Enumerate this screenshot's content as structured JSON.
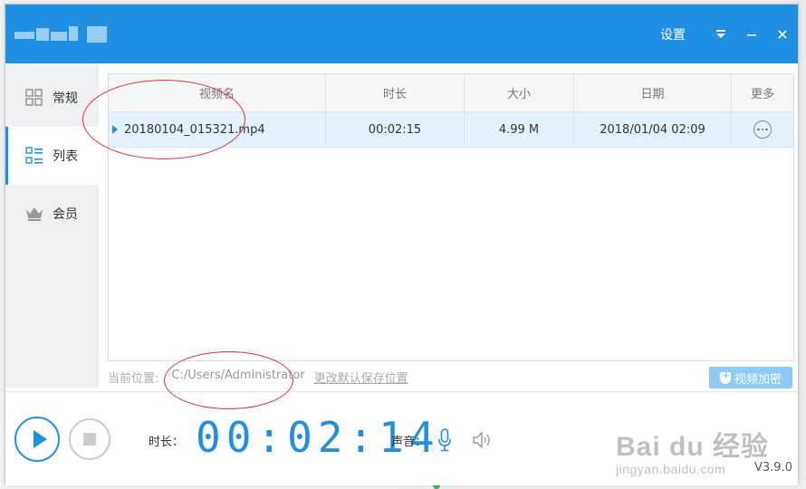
{
  "titlebar": {
    "settings_label": "设置",
    "icons": [
      "dropdown-icon",
      "minimize-icon",
      "close-icon"
    ],
    "accent_color": "#1e8fe3"
  },
  "sidebar": {
    "items": [
      {
        "label": "常规",
        "icon": "grid-icon",
        "active": false
      },
      {
        "label": "列表",
        "icon": "list-icon",
        "active": true
      },
      {
        "label": "会员",
        "icon": "crown-icon",
        "active": false
      }
    ]
  },
  "table": {
    "columns": [
      "视频名",
      "时长",
      "大小",
      "日期",
      "更多"
    ],
    "rows": [
      {
        "name": "20180104_015321.mp4",
        "duration": "00:02:15",
        "size": "4.99 M",
        "date": "2018/01/04 02:09",
        "more_icon": "more-circle-icon"
      }
    ]
  },
  "path": {
    "label": "当前位置:",
    "value": "C:/Users/Administrator",
    "change_link": "更改默认保存位置"
  },
  "encrypt_button": "视频加密",
  "recorder": {
    "duration_label": "时长：",
    "timer": "00:02:14",
    "volume_label": "声音：",
    "version": "V3.9.0"
  },
  "watermark": {
    "main": "Bai du 经验",
    "sub": "jingyan.baidu.com"
  }
}
